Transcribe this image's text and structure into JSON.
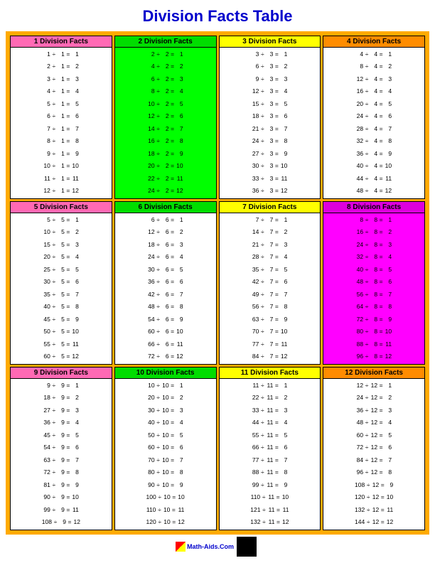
{
  "title": "Division Facts Table",
  "sections": [
    {
      "id": 1,
      "label": "1 Division Facts",
      "divisor": 1,
      "hdrClass": "hdr-1",
      "facts": [
        {
          "a": 1,
          "b": 1,
          "r": 1
        },
        {
          "a": 2,
          "b": 1,
          "r": 2
        },
        {
          "a": 3,
          "b": 1,
          "r": 3
        },
        {
          "a": 4,
          "b": 1,
          "r": 4
        },
        {
          "a": 5,
          "b": 1,
          "r": 5
        },
        {
          "a": 6,
          "b": 1,
          "r": 6
        },
        {
          "a": 7,
          "b": 1,
          "r": 7
        },
        {
          "a": 8,
          "b": 1,
          "r": 8
        },
        {
          "a": 9,
          "b": 1,
          "r": 9
        },
        {
          "a": 10,
          "b": 1,
          "r": 10
        },
        {
          "a": 11,
          "b": 1,
          "r": 11
        },
        {
          "a": 12,
          "b": 1,
          "r": 12
        }
      ]
    },
    {
      "id": 2,
      "label": "2 Division Facts",
      "divisor": 2,
      "hdrClass": "hdr-2",
      "facts": [
        {
          "a": 2,
          "b": 2,
          "r": 1
        },
        {
          "a": 4,
          "b": 2,
          "r": 2
        },
        {
          "a": 6,
          "b": 2,
          "r": 3
        },
        {
          "a": 8,
          "b": 2,
          "r": 4
        },
        {
          "a": 10,
          "b": 2,
          "r": 5
        },
        {
          "a": 12,
          "b": 2,
          "r": 6
        },
        {
          "a": 14,
          "b": 2,
          "r": 7
        },
        {
          "a": 16,
          "b": 2,
          "r": 8
        },
        {
          "a": 18,
          "b": 2,
          "r": 9
        },
        {
          "a": 20,
          "b": 2,
          "r": 10
        },
        {
          "a": 22,
          "b": 2,
          "r": 11
        },
        {
          "a": 24,
          "b": 2,
          "r": 12
        }
      ]
    },
    {
      "id": 3,
      "label": "3 Division Facts",
      "divisor": 3,
      "hdrClass": "hdr-3",
      "facts": [
        {
          "a": 3,
          "b": 3,
          "r": 1
        },
        {
          "a": 6,
          "b": 3,
          "r": 2
        },
        {
          "a": 9,
          "b": 3,
          "r": 3
        },
        {
          "a": 12,
          "b": 3,
          "r": 4
        },
        {
          "a": 15,
          "b": 3,
          "r": 5
        },
        {
          "a": 18,
          "b": 3,
          "r": 6
        },
        {
          "a": 21,
          "b": 3,
          "r": 7
        },
        {
          "a": 24,
          "b": 3,
          "r": 8
        },
        {
          "a": 27,
          "b": 3,
          "r": 9
        },
        {
          "a": 30,
          "b": 3,
          "r": 10
        },
        {
          "a": 33,
          "b": 3,
          "r": 11
        },
        {
          "a": 36,
          "b": 3,
          "r": 12
        }
      ]
    },
    {
      "id": 4,
      "label": "4 Division Facts",
      "divisor": 4,
      "hdrClass": "hdr-4",
      "facts": [
        {
          "a": 4,
          "b": 4,
          "r": 1
        },
        {
          "a": 8,
          "b": 4,
          "r": 2
        },
        {
          "a": 12,
          "b": 4,
          "r": 3
        },
        {
          "a": 16,
          "b": 4,
          "r": 4
        },
        {
          "a": 20,
          "b": 4,
          "r": 5
        },
        {
          "a": 24,
          "b": 4,
          "r": 6
        },
        {
          "a": 28,
          "b": 4,
          "r": 7
        },
        {
          "a": 32,
          "b": 4,
          "r": 8
        },
        {
          "a": 36,
          "b": 4,
          "r": 9
        },
        {
          "a": 40,
          "b": 4,
          "r": 10
        },
        {
          "a": 44,
          "b": 4,
          "r": 11
        },
        {
          "a": 48,
          "b": 4,
          "r": 12
        }
      ]
    },
    {
      "id": 5,
      "label": "5 Division Facts",
      "divisor": 5,
      "hdrClass": "hdr-5",
      "facts": [
        {
          "a": 5,
          "b": 5,
          "r": 1
        },
        {
          "a": 10,
          "b": 5,
          "r": 2
        },
        {
          "a": 15,
          "b": 5,
          "r": 3
        },
        {
          "a": 20,
          "b": 5,
          "r": 4
        },
        {
          "a": 25,
          "b": 5,
          "r": 5
        },
        {
          "a": 30,
          "b": 5,
          "r": 6
        },
        {
          "a": 35,
          "b": 5,
          "r": 7
        },
        {
          "a": 40,
          "b": 5,
          "r": 8
        },
        {
          "a": 45,
          "b": 5,
          "r": 9
        },
        {
          "a": 50,
          "b": 5,
          "r": 10
        },
        {
          "a": 55,
          "b": 5,
          "r": 11
        },
        {
          "a": 60,
          "b": 5,
          "r": 12
        }
      ]
    },
    {
      "id": 6,
      "label": "6 Division Facts",
      "divisor": 6,
      "hdrClass": "hdr-6",
      "facts": [
        {
          "a": 6,
          "b": 6,
          "r": 1
        },
        {
          "a": 12,
          "b": 6,
          "r": 2
        },
        {
          "a": 18,
          "b": 6,
          "r": 3
        },
        {
          "a": 24,
          "b": 6,
          "r": 4
        },
        {
          "a": 30,
          "b": 6,
          "r": 5
        },
        {
          "a": 36,
          "b": 6,
          "r": 6
        },
        {
          "a": 42,
          "b": 6,
          "r": 7
        },
        {
          "a": 48,
          "b": 6,
          "r": 8
        },
        {
          "a": 54,
          "b": 6,
          "r": 9
        },
        {
          "a": 60,
          "b": 6,
          "r": 10
        },
        {
          "a": 66,
          "b": 6,
          "r": 11
        },
        {
          "a": 72,
          "b": 6,
          "r": 12
        }
      ]
    },
    {
      "id": 7,
      "label": "7 Division Facts",
      "divisor": 7,
      "hdrClass": "hdr-7",
      "facts": [
        {
          "a": 7,
          "b": 7,
          "r": 1
        },
        {
          "a": 14,
          "b": 7,
          "r": 2
        },
        {
          "a": 21,
          "b": 7,
          "r": 3
        },
        {
          "a": 28,
          "b": 7,
          "r": 4
        },
        {
          "a": 35,
          "b": 7,
          "r": 5
        },
        {
          "a": 42,
          "b": 7,
          "r": 6
        },
        {
          "a": 49,
          "b": 7,
          "r": 7
        },
        {
          "a": 56,
          "b": 7,
          "r": 8
        },
        {
          "a": 63,
          "b": 7,
          "r": 9
        },
        {
          "a": 70,
          "b": 7,
          "r": 10
        },
        {
          "a": 77,
          "b": 7,
          "r": 11
        },
        {
          "a": 84,
          "b": 7,
          "r": 12
        }
      ]
    },
    {
      "id": 8,
      "label": "8 Division Facts",
      "divisor": 8,
      "hdrClass": "hdr-8",
      "facts": [
        {
          "a": 8,
          "b": 8,
          "r": 1
        },
        {
          "a": 16,
          "b": 8,
          "r": 2
        },
        {
          "a": 24,
          "b": 8,
          "r": 3
        },
        {
          "a": 32,
          "b": 8,
          "r": 4
        },
        {
          "a": 40,
          "b": 8,
          "r": 5
        },
        {
          "a": 48,
          "b": 8,
          "r": 6
        },
        {
          "a": 56,
          "b": 8,
          "r": 7
        },
        {
          "a": 64,
          "b": 8,
          "r": 8
        },
        {
          "a": 72,
          "b": 8,
          "r": 9
        },
        {
          "a": 80,
          "b": 8,
          "r": 10
        },
        {
          "a": 88,
          "b": 8,
          "r": 11
        },
        {
          "a": 96,
          "b": 8,
          "r": 12
        }
      ]
    },
    {
      "id": 9,
      "label": "9 Division Facts",
      "divisor": 9,
      "hdrClass": "hdr-9",
      "facts": [
        {
          "a": 9,
          "b": 9,
          "r": 1
        },
        {
          "a": 18,
          "b": 9,
          "r": 2
        },
        {
          "a": 27,
          "b": 9,
          "r": 3
        },
        {
          "a": 36,
          "b": 9,
          "r": 4
        },
        {
          "a": 45,
          "b": 9,
          "r": 5
        },
        {
          "a": 54,
          "b": 9,
          "r": 6
        },
        {
          "a": 63,
          "b": 9,
          "r": 7
        },
        {
          "a": 72,
          "b": 9,
          "r": 8
        },
        {
          "a": 81,
          "b": 9,
          "r": 9
        },
        {
          "a": 90,
          "b": 9,
          "r": 10
        },
        {
          "a": 99,
          "b": 9,
          "r": 11
        },
        {
          "a": 108,
          "b": 9,
          "r": 12
        }
      ]
    },
    {
      "id": 10,
      "label": "10 Division Facts",
      "divisor": 10,
      "hdrClass": "hdr-10",
      "facts": [
        {
          "a": 10,
          "b": 10,
          "r": 1
        },
        {
          "a": 20,
          "b": 10,
          "r": 2
        },
        {
          "a": 30,
          "b": 10,
          "r": 3
        },
        {
          "a": 40,
          "b": 10,
          "r": 4
        },
        {
          "a": 50,
          "b": 10,
          "r": 5
        },
        {
          "a": 60,
          "b": 10,
          "r": 6
        },
        {
          "a": 70,
          "b": 10,
          "r": 7
        },
        {
          "a": 80,
          "b": 10,
          "r": 8
        },
        {
          "a": 90,
          "b": 10,
          "r": 9
        },
        {
          "a": 100,
          "b": 10,
          "r": 10
        },
        {
          "a": 110,
          "b": 10,
          "r": 11
        },
        {
          "a": 120,
          "b": 10,
          "r": 12
        }
      ]
    },
    {
      "id": 11,
      "label": "11 Division Facts",
      "divisor": 11,
      "hdrClass": "hdr-11",
      "facts": [
        {
          "a": 11,
          "b": 11,
          "r": 1
        },
        {
          "a": 22,
          "b": 11,
          "r": 2
        },
        {
          "a": 33,
          "b": 11,
          "r": 3
        },
        {
          "a": 44,
          "b": 11,
          "r": 4
        },
        {
          "a": 55,
          "b": 11,
          "r": 5
        },
        {
          "a": 66,
          "b": 11,
          "r": 6
        },
        {
          "a": 77,
          "b": 11,
          "r": 7
        },
        {
          "a": 88,
          "b": 11,
          "r": 8
        },
        {
          "a": 99,
          "b": 11,
          "r": 9
        },
        {
          "a": 110,
          "b": 11,
          "r": 10
        },
        {
          "a": 121,
          "b": 11,
          "r": 11
        },
        {
          "a": 132,
          "b": 11,
          "r": 12
        }
      ]
    },
    {
      "id": 12,
      "label": "12 Division Facts",
      "divisor": 12,
      "hdrClass": "hdr-12",
      "facts": [
        {
          "a": 12,
          "b": 12,
          "r": 1
        },
        {
          "a": 24,
          "b": 12,
          "r": 2
        },
        {
          "a": 36,
          "b": 12,
          "r": 3
        },
        {
          "a": 48,
          "b": 12,
          "r": 4
        },
        {
          "a": 60,
          "b": 12,
          "r": 5
        },
        {
          "a": 72,
          "b": 12,
          "r": 6
        },
        {
          "a": 84,
          "b": 12,
          "r": 7
        },
        {
          "a": 96,
          "b": 12,
          "r": 8
        },
        {
          "a": 108,
          "b": 12,
          "r": 9
        },
        {
          "a": 120,
          "b": 12,
          "r": 10
        },
        {
          "a": 132,
          "b": 12,
          "r": 11
        },
        {
          "a": 144,
          "b": 12,
          "r": 12
        }
      ]
    }
  ],
  "footer": {
    "site": "Math-Aids.Com"
  }
}
